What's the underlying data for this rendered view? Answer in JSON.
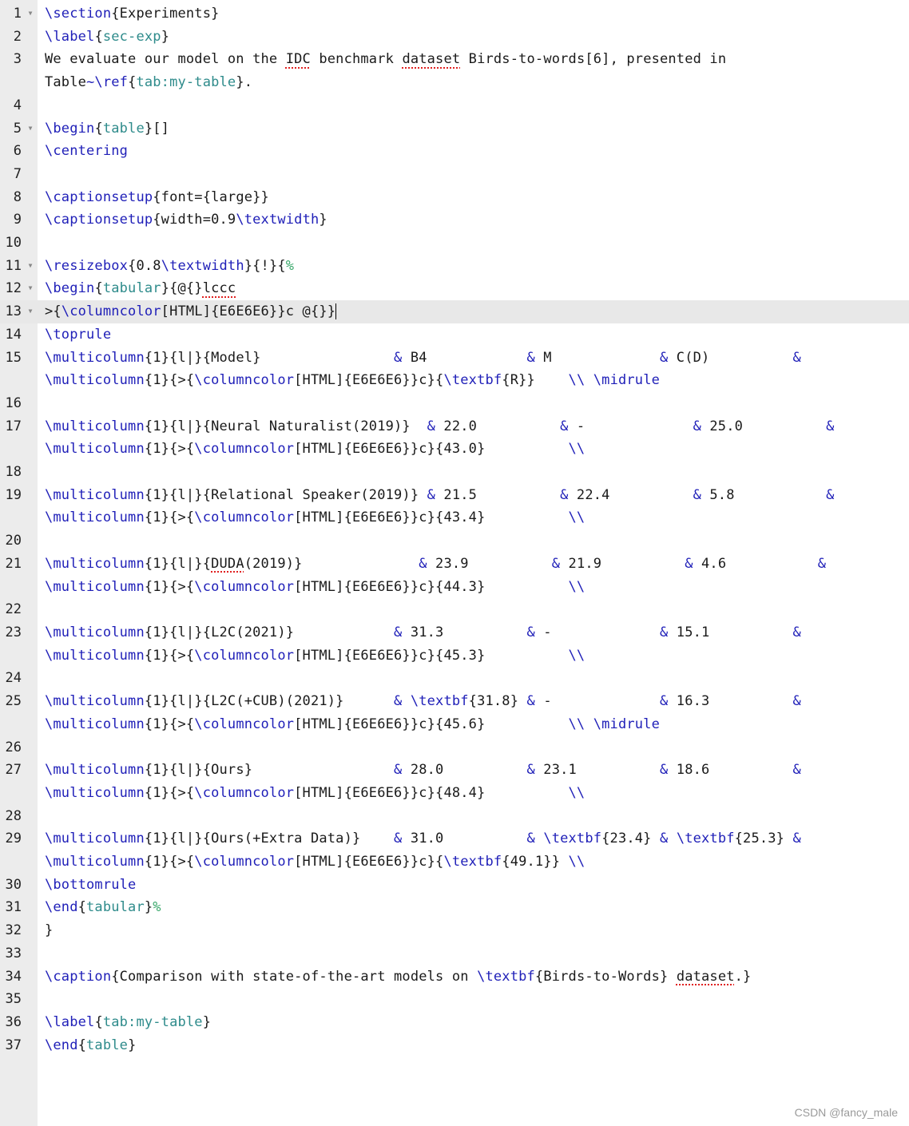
{
  "editor": {
    "lines": [
      {
        "n": "1",
        "fold": true,
        "rows": [
          [
            [
              "cmd",
              "\\section"
            ],
            [
              "t",
              "{Experiments}"
            ]
          ]
        ]
      },
      {
        "n": "2",
        "rows": [
          [
            [
              "cmd",
              "\\label"
            ],
            [
              "t",
              "{"
            ],
            [
              "arg",
              "sec-exp"
            ],
            [
              "t",
              "}"
            ]
          ]
        ]
      },
      {
        "n": "3",
        "rows": [
          [
            [
              "t",
              "We evaluate our model on the "
            ],
            [
              "sq",
              "IDC"
            ],
            [
              "t",
              " benchmark "
            ],
            [
              "sq",
              "dataset"
            ],
            [
              "t",
              " Birds-to-words[6], presented in"
            ]
          ],
          [
            [
              "t",
              "Table"
            ],
            [
              "cmd",
              "~\\ref"
            ],
            [
              "t",
              "{"
            ],
            [
              "arg",
              "tab:my-table"
            ],
            [
              "t",
              "}."
            ]
          ]
        ]
      },
      {
        "n": "4",
        "rows": [
          []
        ]
      },
      {
        "n": "5",
        "fold": true,
        "rows": [
          [
            [
              "cmd",
              "\\begin"
            ],
            [
              "t",
              "{"
            ],
            [
              "arg",
              "table"
            ],
            [
              "t",
              "}[]"
            ]
          ]
        ]
      },
      {
        "n": "6",
        "rows": [
          [
            [
              "cmd",
              "\\centering"
            ]
          ]
        ]
      },
      {
        "n": "7",
        "rows": [
          []
        ]
      },
      {
        "n": "8",
        "rows": [
          [
            [
              "cmd",
              "\\captionsetup"
            ],
            [
              "t",
              "{font={large}}"
            ]
          ]
        ]
      },
      {
        "n": "9",
        "rows": [
          [
            [
              "cmd",
              "\\captionsetup"
            ],
            [
              "t",
              "{width=0.9"
            ],
            [
              "cmd",
              "\\textwidth"
            ],
            [
              "t",
              "}"
            ]
          ]
        ]
      },
      {
        "n": "10",
        "rows": [
          []
        ]
      },
      {
        "n": "11",
        "fold": true,
        "rows": [
          [
            [
              "cmd",
              "\\resizebox"
            ],
            [
              "t",
              "{0.8"
            ],
            [
              "cmd",
              "\\textwidth"
            ],
            [
              "t",
              "}{!}{"
            ],
            [
              "cmt",
              "%"
            ]
          ]
        ]
      },
      {
        "n": "12",
        "fold": true,
        "rows": [
          [
            [
              "cmd",
              "\\begin"
            ],
            [
              "t",
              "{"
            ],
            [
              "arg",
              "tabular"
            ],
            [
              "t",
              "}{@{}"
            ],
            [
              "sq",
              "lccc"
            ]
          ]
        ]
      },
      {
        "n": "13",
        "fold": true,
        "active": true,
        "rows": [
          [
            [
              "t",
              ">{"
            ],
            [
              "cmd",
              "\\columncolor"
            ],
            [
              "t",
              "[HTML]{E6E6E6}}c @{}}"
            ],
            [
              "caret",
              ""
            ]
          ]
        ]
      },
      {
        "n": "14",
        "rows": [
          [
            [
              "cmd",
              "\\toprule"
            ]
          ]
        ]
      },
      {
        "n": "15",
        "rows": [
          [
            [
              "cmd",
              "\\multicolumn"
            ],
            [
              "t",
              "{1}{l|}{Model}                "
            ],
            [
              "amp",
              "&"
            ],
            [
              "t",
              " B4            "
            ],
            [
              "amp",
              "&"
            ],
            [
              "t",
              " M             "
            ],
            [
              "amp",
              "&"
            ],
            [
              "t",
              " C(D)          "
            ],
            [
              "amp",
              "&"
            ]
          ],
          [
            [
              "cmd",
              "\\multicolumn"
            ],
            [
              "t",
              "{1}{>{"
            ],
            [
              "cmd",
              "\\columncolor"
            ],
            [
              "t",
              "[HTML]{E6E6E6}}c}{"
            ],
            [
              "cmd",
              "\\textbf"
            ],
            [
              "t",
              "{R}}    "
            ],
            [
              "cmd",
              "\\\\ \\midrule"
            ]
          ]
        ]
      },
      {
        "n": "16",
        "rows": [
          []
        ]
      },
      {
        "n": "17",
        "rows": [
          [
            [
              "cmd",
              "\\multicolumn"
            ],
            [
              "t",
              "{1}{l|}{Neural Naturalist(2019)}  "
            ],
            [
              "amp",
              "&"
            ],
            [
              "t",
              " 22.0          "
            ],
            [
              "amp",
              "&"
            ],
            [
              "t",
              " -             "
            ],
            [
              "amp",
              "&"
            ],
            [
              "t",
              " 25.0          "
            ],
            [
              "amp",
              "&"
            ]
          ],
          [
            [
              "cmd",
              "\\multicolumn"
            ],
            [
              "t",
              "{1}{>{"
            ],
            [
              "cmd",
              "\\columncolor"
            ],
            [
              "t",
              "[HTML]{E6E6E6}}c}{43.0}          "
            ],
            [
              "cmd",
              "\\\\"
            ]
          ]
        ]
      },
      {
        "n": "18",
        "rows": [
          []
        ]
      },
      {
        "n": "19",
        "rows": [
          [
            [
              "cmd",
              "\\multicolumn"
            ],
            [
              "t",
              "{1}{l|}{Relational Speaker(2019)} "
            ],
            [
              "amp",
              "&"
            ],
            [
              "t",
              " 21.5          "
            ],
            [
              "amp",
              "&"
            ],
            [
              "t",
              " 22.4          "
            ],
            [
              "amp",
              "&"
            ],
            [
              "t",
              " 5.8           "
            ],
            [
              "amp",
              "&"
            ]
          ],
          [
            [
              "cmd",
              "\\multicolumn"
            ],
            [
              "t",
              "{1}{>{"
            ],
            [
              "cmd",
              "\\columncolor"
            ],
            [
              "t",
              "[HTML]{E6E6E6}}c}{43.4}          "
            ],
            [
              "cmd",
              "\\\\"
            ]
          ]
        ]
      },
      {
        "n": "20",
        "rows": [
          []
        ]
      },
      {
        "n": "21",
        "rows": [
          [
            [
              "cmd",
              "\\multicolumn"
            ],
            [
              "t",
              "{1}{l|}{"
            ],
            [
              "sq",
              "DUDA"
            ],
            [
              "t",
              "(2019)}              "
            ],
            [
              "amp",
              "&"
            ],
            [
              "t",
              " 23.9          "
            ],
            [
              "amp",
              "&"
            ],
            [
              "t",
              " 21.9          "
            ],
            [
              "amp",
              "&"
            ],
            [
              "t",
              " 4.6           "
            ],
            [
              "amp",
              "&"
            ]
          ],
          [
            [
              "cmd",
              "\\multicolumn"
            ],
            [
              "t",
              "{1}{>{"
            ],
            [
              "cmd",
              "\\columncolor"
            ],
            [
              "t",
              "[HTML]{E6E6E6}}c}{44.3}          "
            ],
            [
              "cmd",
              "\\\\"
            ]
          ]
        ]
      },
      {
        "n": "22",
        "rows": [
          []
        ]
      },
      {
        "n": "23",
        "rows": [
          [
            [
              "cmd",
              "\\multicolumn"
            ],
            [
              "t",
              "{1}{l|}{L2C(2021)}            "
            ],
            [
              "amp",
              "&"
            ],
            [
              "t",
              " 31.3          "
            ],
            [
              "amp",
              "&"
            ],
            [
              "t",
              " -             "
            ],
            [
              "amp",
              "&"
            ],
            [
              "t",
              " 15.1          "
            ],
            [
              "amp",
              "&"
            ]
          ],
          [
            [
              "cmd",
              "\\multicolumn"
            ],
            [
              "t",
              "{1}{>{"
            ],
            [
              "cmd",
              "\\columncolor"
            ],
            [
              "t",
              "[HTML]{E6E6E6}}c}{45.3}          "
            ],
            [
              "cmd",
              "\\\\"
            ]
          ]
        ]
      },
      {
        "n": "24",
        "rows": [
          []
        ]
      },
      {
        "n": "25",
        "rows": [
          [
            [
              "cmd",
              "\\multicolumn"
            ],
            [
              "t",
              "{1}{l|}{L2C(+CUB)(2021)}      "
            ],
            [
              "amp",
              "&"
            ],
            [
              "t",
              " "
            ],
            [
              "cmd",
              "\\textbf"
            ],
            [
              "t",
              "{31.8} "
            ],
            [
              "amp",
              "&"
            ],
            [
              "t",
              " -             "
            ],
            [
              "amp",
              "&"
            ],
            [
              "t",
              " 16.3          "
            ],
            [
              "amp",
              "&"
            ]
          ],
          [
            [
              "cmd",
              "\\multicolumn"
            ],
            [
              "t",
              "{1}{>{"
            ],
            [
              "cmd",
              "\\columncolor"
            ],
            [
              "t",
              "[HTML]{E6E6E6}}c}{45.6}          "
            ],
            [
              "cmd",
              "\\\\ \\midrule"
            ]
          ]
        ]
      },
      {
        "n": "26",
        "rows": [
          []
        ]
      },
      {
        "n": "27",
        "rows": [
          [
            [
              "cmd",
              "\\multicolumn"
            ],
            [
              "t",
              "{1}{l|}{Ours}                 "
            ],
            [
              "amp",
              "&"
            ],
            [
              "t",
              " 28.0          "
            ],
            [
              "amp",
              "&"
            ],
            [
              "t",
              " 23.1          "
            ],
            [
              "amp",
              "&"
            ],
            [
              "t",
              " 18.6          "
            ],
            [
              "amp",
              "&"
            ]
          ],
          [
            [
              "cmd",
              "\\multicolumn"
            ],
            [
              "t",
              "{1}{>{"
            ],
            [
              "cmd",
              "\\columncolor"
            ],
            [
              "t",
              "[HTML]{E6E6E6}}c}{48.4}          "
            ],
            [
              "cmd",
              "\\\\"
            ]
          ]
        ]
      },
      {
        "n": "28",
        "rows": [
          []
        ]
      },
      {
        "n": "29",
        "rows": [
          [
            [
              "cmd",
              "\\multicolumn"
            ],
            [
              "t",
              "{1}{l|}{Ours(+Extra Data)}    "
            ],
            [
              "amp",
              "&"
            ],
            [
              "t",
              " 31.0          "
            ],
            [
              "amp",
              "&"
            ],
            [
              "t",
              " "
            ],
            [
              "cmd",
              "\\textbf"
            ],
            [
              "t",
              "{23.4} "
            ],
            [
              "amp",
              "&"
            ],
            [
              "t",
              " "
            ],
            [
              "cmd",
              "\\textbf"
            ],
            [
              "t",
              "{25.3} "
            ],
            [
              "amp",
              "&"
            ]
          ],
          [
            [
              "cmd",
              "\\multicolumn"
            ],
            [
              "t",
              "{1}{>{"
            ],
            [
              "cmd",
              "\\columncolor"
            ],
            [
              "t",
              "[HTML]{E6E6E6}}c}{"
            ],
            [
              "cmd",
              "\\textbf"
            ],
            [
              "t",
              "{49.1}} "
            ],
            [
              "cmd",
              "\\\\"
            ]
          ]
        ]
      },
      {
        "n": "30",
        "rows": [
          [
            [
              "cmd",
              "\\bottomrule"
            ]
          ]
        ]
      },
      {
        "n": "31",
        "rows": [
          [
            [
              "cmd",
              "\\end"
            ],
            [
              "t",
              "{"
            ],
            [
              "arg",
              "tabular"
            ],
            [
              "t",
              "}"
            ],
            [
              "cmt",
              "%"
            ]
          ]
        ]
      },
      {
        "n": "32",
        "rows": [
          [
            [
              "t",
              "}"
            ]
          ]
        ]
      },
      {
        "n": "33",
        "rows": [
          []
        ]
      },
      {
        "n": "34",
        "rows": [
          [
            [
              "cmd",
              "\\caption"
            ],
            [
              "t",
              "{Comparison with state-of-the-art models on "
            ],
            [
              "cmd",
              "\\textbf"
            ],
            [
              "t",
              "{Birds-to-Words} "
            ],
            [
              "sq",
              "dataset"
            ],
            [
              "t",
              ".}"
            ]
          ]
        ]
      },
      {
        "n": "35",
        "rows": [
          []
        ]
      },
      {
        "n": "36",
        "rows": [
          [
            [
              "cmd",
              "\\label"
            ],
            [
              "t",
              "{"
            ],
            [
              "arg",
              "tab:my-table"
            ],
            [
              "t",
              "}"
            ]
          ]
        ]
      },
      {
        "n": "37",
        "rows": [
          [
            [
              "cmd",
              "\\end"
            ],
            [
              "t",
              "{"
            ],
            [
              "arg",
              "table"
            ],
            [
              "t",
              "}"
            ]
          ]
        ]
      }
    ]
  },
  "watermark": "CSDN @fancy_male",
  "colors": {
    "command": "#1f1fb8",
    "argument": "#2e8b8b",
    "comment": "#3aa86b",
    "spellcheck": "#e02020",
    "gutter": "#ececec",
    "active_line": "#e8e8e8"
  }
}
